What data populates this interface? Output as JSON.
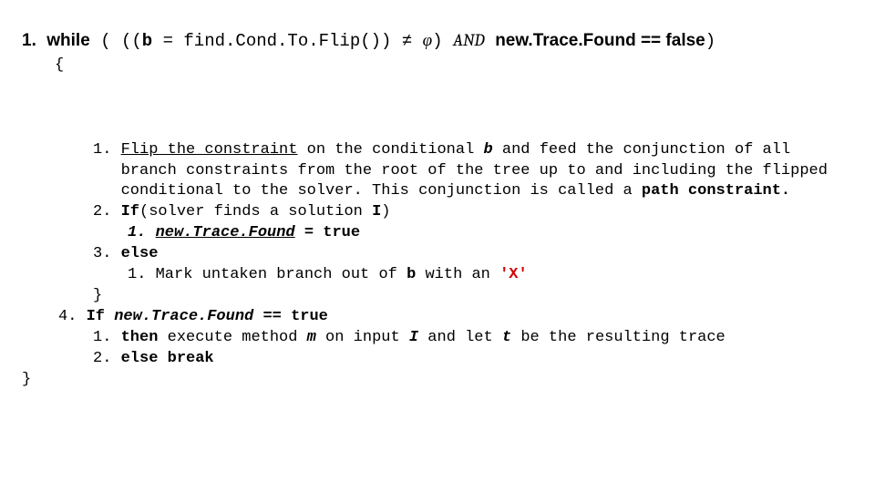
{
  "top": {
    "num": "1.",
    "while": "while",
    "open": " ( ((",
    "b": "b",
    "assign": " = find.Cond.To.Flip()) ",
    "neq": "≠ ",
    "phi": "φ",
    "close1": ") ",
    "and": "AND",
    "sp": "  ",
    "ntf": "new.Trace.Found == false",
    "close2": ")",
    "lbrace": "{"
  },
  "l1": {
    "n": "1. ",
    "a": "Flip the constraint",
    "b": " on the conditional ",
    "c": "b",
    "d": " and feed the conjunction of all branch constraints from the root of the tree up to and including the flipped conditional to the solver. This conjunction is called a ",
    "e": "path constraint.",
    "f": " "
  },
  "l2": {
    "n": "2. ",
    "a": "If",
    "b": "(solver finds a solution ",
    "c": "I",
    "d": ")"
  },
  "l2a": {
    "n": "1. ",
    "a": "new.Trace.Found",
    "b": " = ",
    "c": "true"
  },
  "l3": {
    "n": "3. ",
    "a": "else"
  },
  "l3a": {
    "n": "1. ",
    "a": "Mark untaken branch out of ",
    "b": "b",
    "c": " with an ",
    "d": "'X'"
  },
  "rb": "}",
  "l4": {
    "n": "4. ",
    "a": "If",
    "b": " ",
    "c": "new.Trace.Found",
    "d": " == ",
    "e": "true"
  },
  "l4a": {
    "n": "1. ",
    "a": "then",
    "b": "  execute method ",
    "c": "m",
    "d": " on input ",
    "e": "I",
    "f": " and let ",
    "g": "t",
    "h": " be the resulting trace"
  },
  "l4b": {
    "n": "2. ",
    "a": "else break"
  },
  "end": "}"
}
